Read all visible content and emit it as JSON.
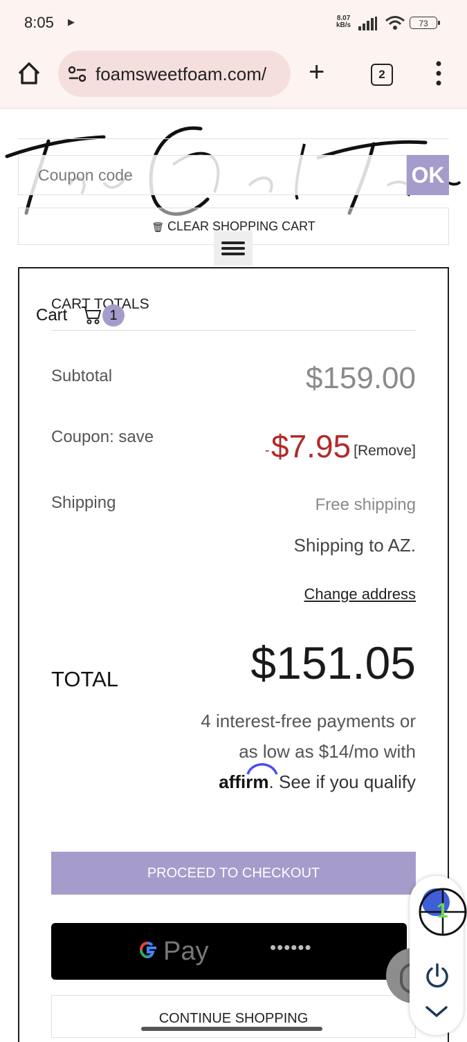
{
  "status_bar": {
    "time": "8:05",
    "net_speed_value": "8.07",
    "net_speed_unit": "kB/s",
    "battery": "73"
  },
  "browser": {
    "url": "foamsweetfoam.com/",
    "tab_count": "2"
  },
  "coupon": {
    "placeholder": "Coupon code",
    "apply_label": "OK"
  },
  "clear_cart_label": "CLEAR SHOPPING CART",
  "cart": {
    "label": "Cart",
    "count": "1"
  },
  "totals": {
    "title": "CART TOTALS",
    "subtotal_label": "Subtotal",
    "subtotal_value": "$159.00",
    "coupon_label": "Coupon: save",
    "coupon_minus": "-",
    "coupon_value": "$7.95",
    "coupon_remove": "[Remove]",
    "shipping_label": "Shipping",
    "shipping_value": "Free shipping",
    "shipping_to": "Shipping to AZ.",
    "change_address": "Change address",
    "total_label": "TOTAL",
    "total_value": "$151.05"
  },
  "affirm": {
    "line1": "4 interest-free payments or",
    "line2": "as low as $14/mo with",
    "logo": "affirm",
    "line3": ". See if you qualify"
  },
  "buttons": {
    "checkout": "PROCEED TO CHECKOUT",
    "gpay": "Pay",
    "gpay_card_mask": "••••••",
    "continue": "CONTINUE SHOPPING"
  },
  "overlay": {
    "marker_number": "1"
  },
  "colors": {
    "accent": "#a69ccb",
    "discount": "#b22a2a",
    "browser_bg": "#fdf4f1",
    "url_pill": "#f5dfdc"
  },
  "icons": [
    "home-icon",
    "site-settings-icon",
    "plus-icon",
    "tab-switcher-icon",
    "more-vert-icon",
    "hamburger-icon",
    "cart-icon",
    "trash-icon",
    "power-icon",
    "chevron-down-icon"
  ]
}
